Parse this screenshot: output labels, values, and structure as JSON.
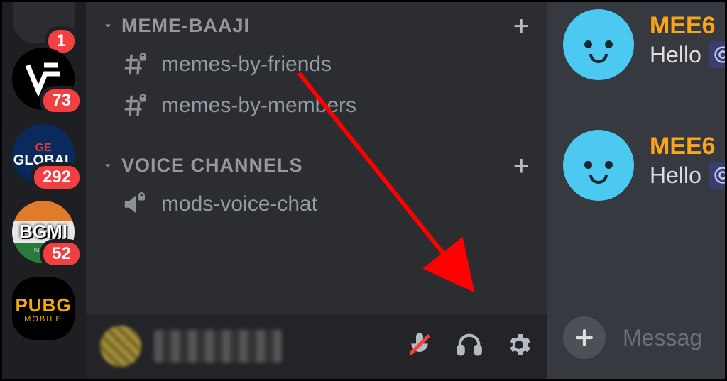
{
  "servers": [
    {
      "label": "VF",
      "badge": "73"
    },
    {
      "label": "GLOBAL",
      "badge": "292"
    },
    {
      "label": "BGMI",
      "badge": "52"
    },
    {
      "label_line1": "PUBG",
      "label_line2": "MOBILE",
      "badge": ""
    }
  ],
  "sidebar": {
    "categories": [
      {
        "name": "MEME-BAAJI",
        "channels": [
          {
            "name": "memes-by-friends",
            "type": "text-locked"
          },
          {
            "name": "memes-by-members",
            "type": "text-locked"
          }
        ]
      },
      {
        "name": "VOICE CHANNELS",
        "channels": [
          {
            "name": "mods-voice-chat",
            "type": "voice-locked"
          }
        ]
      }
    ]
  },
  "messages": [
    {
      "author": "MEE6",
      "text": "Hello"
    },
    {
      "author": "MEE6",
      "text": "Hello"
    }
  ],
  "composer": {
    "placeholder": "Messag"
  }
}
